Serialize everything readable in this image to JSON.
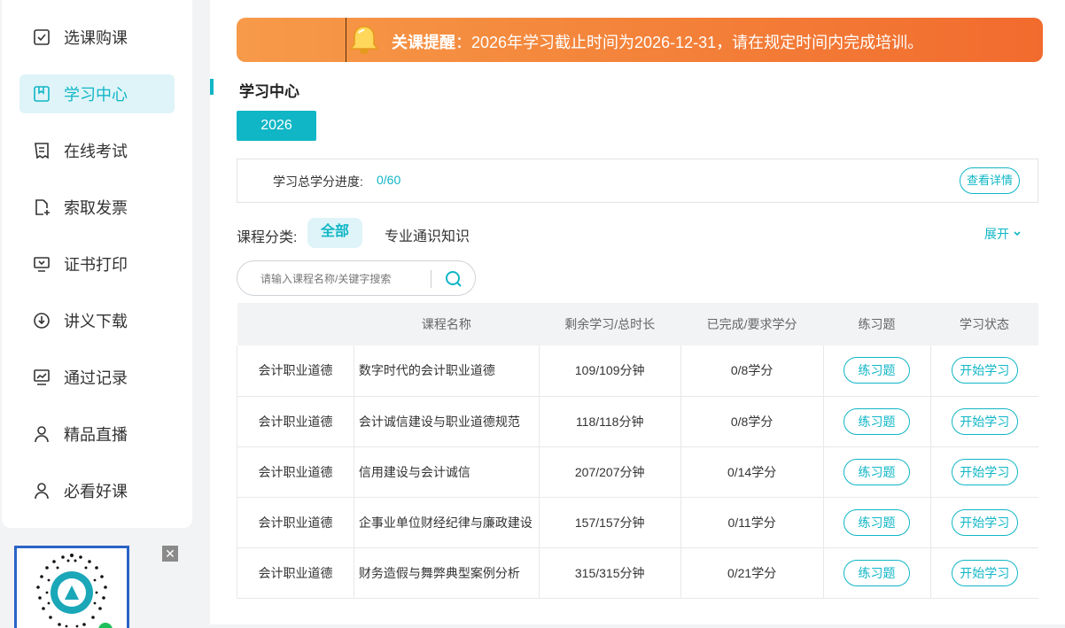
{
  "sidebar": {
    "items": [
      {
        "label": "选课购课",
        "icon": "checkbox-icon",
        "active": false
      },
      {
        "label": "学习中心",
        "icon": "bookmark-book-icon",
        "active": true
      },
      {
        "label": "在线考试",
        "icon": "document-list-icon",
        "active": false
      },
      {
        "label": "索取发票",
        "icon": "file-add-icon",
        "active": false
      },
      {
        "label": "证书打印",
        "icon": "monitor-icon",
        "active": false
      },
      {
        "label": "讲义下载",
        "icon": "download-circle-icon",
        "active": false
      },
      {
        "label": "通过记录",
        "icon": "chart-screen-icon",
        "active": false
      },
      {
        "label": "精品直播",
        "icon": "user-icon",
        "active": false
      },
      {
        "label": "必看好课",
        "icon": "user-icon",
        "active": false
      }
    ],
    "qr_close": "✕"
  },
  "notice": {
    "title": "关课提醒",
    "message": "：2026年学习截止时间为2026-12-31，请在规定时间内完成培训。"
  },
  "section": {
    "title": "学习中心"
  },
  "year_tab": "2026",
  "progress": {
    "label": "学习总学分进度:",
    "value": "0/60",
    "detail_button": "查看详情"
  },
  "category": {
    "label": "课程分类:",
    "all": "全部",
    "professional": "专业通识知识",
    "expand": "展开"
  },
  "search": {
    "placeholder": "请输入课程名称/关键字搜索"
  },
  "table": {
    "headers": [
      "",
      "课程名称",
      "剩余学习/总时长",
      "已完成/要求学分",
      "练习题",
      "学习状态"
    ],
    "rows": [
      {
        "category": "会计职业道德",
        "name": "数字时代的会计职业道德",
        "remain": "109/109分钟",
        "credit": "0/8学分",
        "practice": "练习题",
        "status": "开始学习"
      },
      {
        "category": "会计职业道德",
        "name": "会计诚信建设与职业道德规范",
        "remain": "118/118分钟",
        "credit": "0/8学分",
        "practice": "练习题",
        "status": "开始学习"
      },
      {
        "category": "会计职业道德",
        "name": "信用建设与会计诚信",
        "remain": "207/207分钟",
        "credit": "0/14学分",
        "practice": "练习题",
        "status": "开始学习"
      },
      {
        "category": "会计职业道德",
        "name": "企事业单位财经纪律与廉政建设",
        "remain": "157/157分钟",
        "credit": "0/11学分",
        "practice": "练习题",
        "status": "开始学习"
      },
      {
        "category": "会计职业道德",
        "name": "财务造假与舞弊典型案例分析",
        "remain": "315/315分钟",
        "credit": "0/21学分",
        "practice": "练习题",
        "status": "开始学习"
      }
    ]
  },
  "colors": {
    "accent": "#10b6c6",
    "notice_start": "#f79a4a",
    "notice_end": "#f26b2e",
    "active_bg": "#dff4f8"
  }
}
